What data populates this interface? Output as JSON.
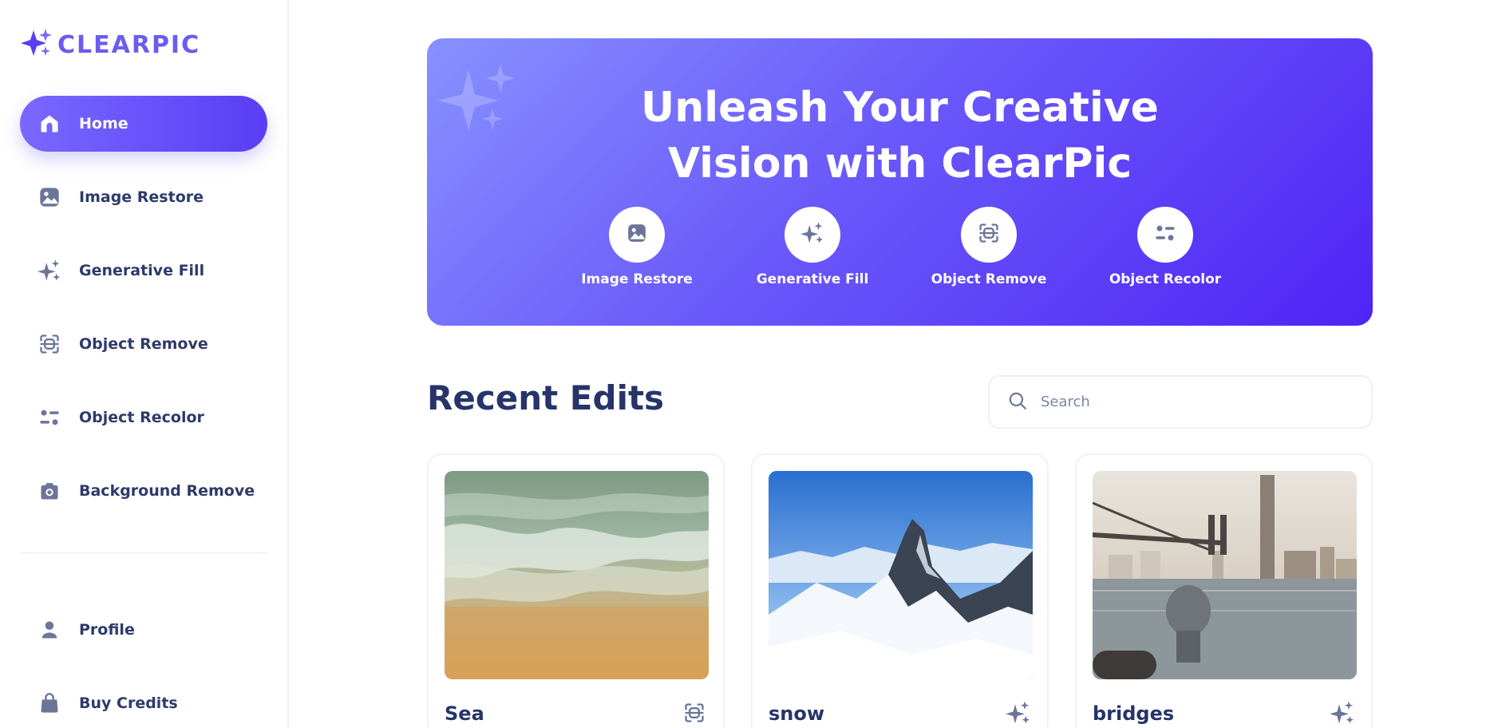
{
  "brand": {
    "name": "CLEARPIC",
    "accent": "#6a5cf0",
    "icon": "sparkles-logo-icon"
  },
  "sidebar": {
    "items": [
      {
        "label": "Home",
        "icon": "home-icon",
        "active": true
      },
      {
        "label": "Image Restore",
        "icon": "image-icon"
      },
      {
        "label": "Generative Fill",
        "icon": "sparkles-icon"
      },
      {
        "label": "Object Remove",
        "icon": "scan-icon"
      },
      {
        "label": "Object Recolor",
        "icon": "filter-icon"
      },
      {
        "label": "Background Remove",
        "icon": "camera-icon"
      }
    ],
    "bottom_items": [
      {
        "label": "Profile",
        "icon": "user-icon"
      },
      {
        "label": "Buy Credits",
        "icon": "shopping-bag-icon"
      }
    ]
  },
  "hero": {
    "title_line1": "Unleash Your Creative",
    "title_line2": "Vision with ClearPic",
    "features": [
      {
        "label": "Image Restore",
        "icon": "image-icon"
      },
      {
        "label": "Generative Fill",
        "icon": "sparkles-icon"
      },
      {
        "label": "Object Remove",
        "icon": "scan-icon"
      },
      {
        "label": "Object Recolor",
        "icon": "filter-icon"
      }
    ]
  },
  "recent": {
    "title": "Recent Edits",
    "search_placeholder": "Search",
    "items": [
      {
        "title": "Sea",
        "icon": "scan-icon",
        "image": "beach-waves-photo"
      },
      {
        "title": "snow",
        "icon": "sparkles-icon",
        "image": "snowy-mountain-photo"
      },
      {
        "title": "bridges",
        "icon": "sparkles-icon",
        "image": "city-bridge-photo"
      }
    ]
  }
}
